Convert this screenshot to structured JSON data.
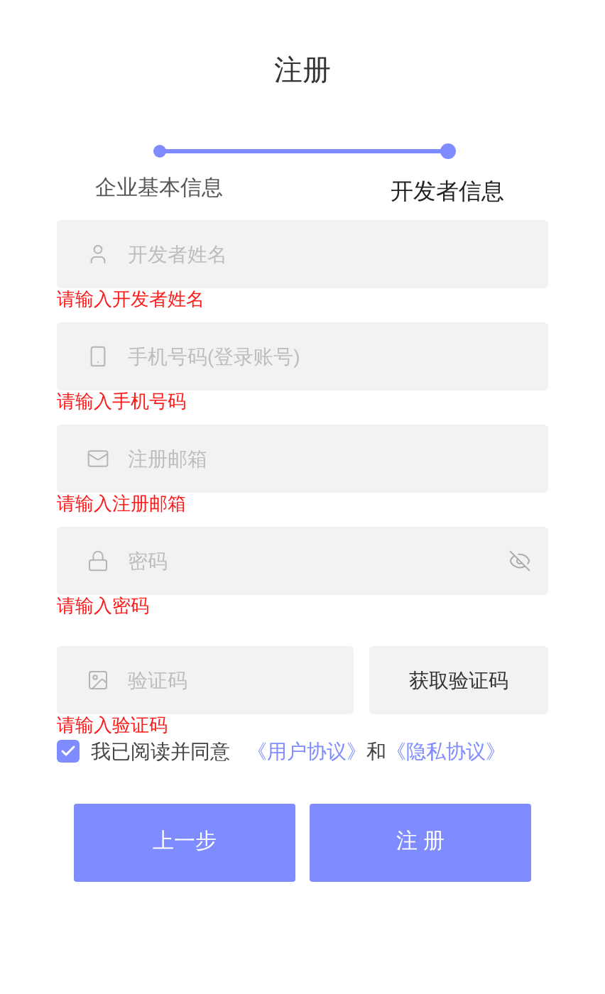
{
  "title": "注册",
  "steps": [
    {
      "label": "企业基本信息",
      "selected": false
    },
    {
      "label": "开发者信息",
      "selected": true
    }
  ],
  "fields": [
    {
      "kind": "user",
      "placeholder": "开发者姓名",
      "error": "请输入开发者姓名"
    },
    {
      "kind": "phone",
      "placeholder": "手机号码(登录账号)",
      "error": "请输入手机号码"
    },
    {
      "kind": "mail",
      "placeholder": "注册邮箱",
      "error": "请输入注册邮箱"
    },
    {
      "kind": "password",
      "placeholder": "密码",
      "error": "请输入密码"
    }
  ],
  "code": {
    "placeholder": "验证码",
    "error": "请输入验证码",
    "button": "获取验证码"
  },
  "agreement": {
    "checked": true,
    "text": "我已阅读并同意",
    "link1": "《用户协议》",
    "and": "和",
    "link2": "《隐私协议》"
  },
  "buttons": [
    {
      "label": "上一步"
    },
    {
      "label": "注 册"
    }
  ]
}
